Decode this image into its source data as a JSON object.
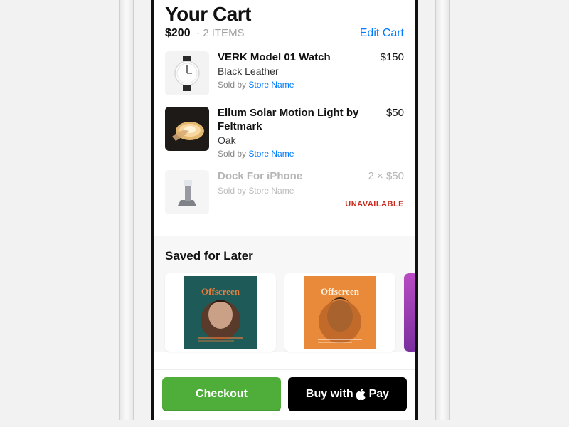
{
  "header": {
    "title": "Your Cart",
    "total": "$200",
    "item_count_label": "2 ITEMS",
    "edit_label": "Edit Cart"
  },
  "items": [
    {
      "name": "VERK Model 01 Watch",
      "variant": "Black Leather",
      "price": "$150",
      "sold_prefix": "Sold by ",
      "store": "Store Name",
      "available": true,
      "thumb": "watch"
    },
    {
      "name": "Ellum Solar Motion Light by Feltmark",
      "variant": "Oak",
      "price": "$50",
      "sold_prefix": "Sold by ",
      "store": "Store Name",
      "available": true,
      "thumb": "light"
    },
    {
      "name": "Dock For iPhone",
      "variant": "",
      "price": "2 × $50",
      "sold_prefix": "Sold by ",
      "store": "Store Name",
      "available": false,
      "status_label": "UNAVAILABLE",
      "thumb": "dock"
    }
  ],
  "saved": {
    "title": "Saved for Later",
    "cards": [
      {
        "label": "Offscreen",
        "tone": "teal"
      },
      {
        "label": "Offscreen",
        "tone": "orange"
      }
    ]
  },
  "footer": {
    "checkout_label": "Checkout",
    "apple_pay_prefix": "Buy with ",
    "apple_pay_suffix": "Pay"
  },
  "colors": {
    "link": "#007aff",
    "primary_btn": "#4fae3a",
    "danger_text": "#c82a1d"
  }
}
